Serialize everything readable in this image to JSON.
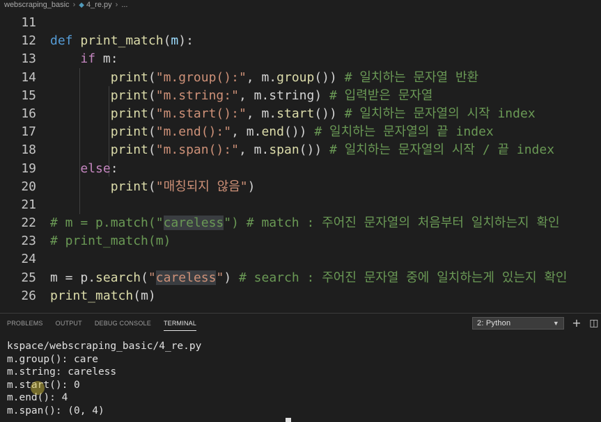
{
  "breadcrumb": {
    "folder": "webscraping_basic",
    "file": "4_re.py",
    "more": "..."
  },
  "editor": {
    "lines": [
      {
        "num": "11"
      },
      {
        "num": "12"
      },
      {
        "num": "13"
      },
      {
        "num": "14"
      },
      {
        "num": "15"
      },
      {
        "num": "16"
      },
      {
        "num": "17"
      },
      {
        "num": "18"
      },
      {
        "num": "19"
      },
      {
        "num": "20"
      },
      {
        "num": "21"
      },
      {
        "num": "22"
      },
      {
        "num": "23"
      },
      {
        "num": "24"
      },
      {
        "num": "25"
      },
      {
        "num": "26"
      }
    ],
    "code": {
      "l12": {
        "kw": "def",
        "fn": "print_match",
        "p1": "(",
        "param": "m",
        "p2": "):"
      },
      "l13": {
        "kw": "if",
        "rest": " m:"
      },
      "l14": {
        "fn": "print",
        "p1": "(",
        "str": "\"m.group():\"",
        "mid": ", m.",
        "fn2": "group",
        "p2": "()) ",
        "cm": "# 일치하는 문자열 반환"
      },
      "l15": {
        "fn": "print",
        "p1": "(",
        "str": "\"m.string:\"",
        "mid": ", m.string) ",
        "cm": "# 입력받은 문자열"
      },
      "l16": {
        "fn": "print",
        "p1": "(",
        "str": "\"m.start():\"",
        "mid": ", m.",
        "fn2": "start",
        "p2": "()) ",
        "cm": "# 일치하는 문자열의 시작 index"
      },
      "l17": {
        "fn": "print",
        "p1": "(",
        "str": "\"m.end():\"",
        "mid": ", m.",
        "fn2": "end",
        "p2": "()) ",
        "cm": "# 일치하는 문자열의 끝 index"
      },
      "l18": {
        "fn": "print",
        "p1": "(",
        "str": "\"m.span():\"",
        "mid": ", m.",
        "fn2": "span",
        "p2": "()) ",
        "cm": "# 일치하는 문자열의 시작 / 끝 index"
      },
      "l19": {
        "kw": "else",
        "rest": ":"
      },
      "l20": {
        "fn": "print",
        "p1": "(",
        "str": "\"매칭되지 않음\"",
        "p2": ")"
      },
      "l22": {
        "cm1": "# m = p.match(\"",
        "hl": "careless",
        "cm2": "\") # match : 주어진 문자열의 처음부터 일치하는지 확인"
      },
      "l23": {
        "cm": "# print_match(m)"
      },
      "l25": {
        "v": "m",
        "op": " = ",
        "v2": "p",
        "dot": ".",
        "fn": "search",
        "p1": "(",
        "s1": "\"",
        "hl": "careless",
        "s2": "\"",
        "p2": ") ",
        "cm": "# search : 주어진 문자열 중에 일치하는게 있는지 확인"
      },
      "l26": {
        "fn": "print_match",
        "p1": "(",
        "v": "m",
        "p2": ")"
      }
    }
  },
  "panel": {
    "tabs": [
      "PROBLEMS",
      "OUTPUT",
      "DEBUG CONSOLE",
      "TERMINAL"
    ],
    "active_tab": "TERMINAL",
    "terminal_select": "2: Python",
    "add_label": "+",
    "split_label": "◫",
    "terminal_lines": [
      "kspace/webscraping_basic/4_re.py",
      "m.group(): care",
      "m.string: careless",
      "m.start(): 0",
      "m.end(): 4",
      "m.span(): (0, 4)"
    ]
  },
  "colors": {
    "background": "#1e1e1e",
    "keyword": "#569cd6",
    "control_keyword": "#c586c0",
    "function": "#dcdcaa",
    "string": "#ce9178",
    "comment": "#6a9955",
    "variable": "#9cdcfe"
  }
}
